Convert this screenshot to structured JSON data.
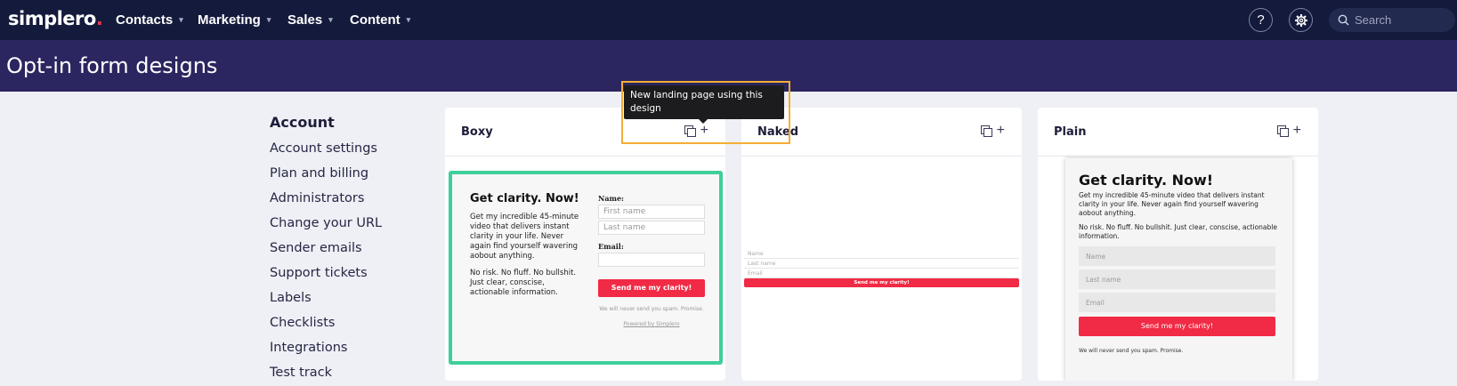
{
  "app": {
    "logo_text": "simplero",
    "logo_dot": "."
  },
  "nav": {
    "items": [
      {
        "label": "Contacts"
      },
      {
        "label": "Marketing"
      },
      {
        "label": "Sales"
      },
      {
        "label": "Content"
      }
    ],
    "help_label": "?",
    "search_placeholder": "Search"
  },
  "page": {
    "title": "Opt-in form designs"
  },
  "sidebar": {
    "heading": "Account",
    "items": [
      {
        "label": "Account settings"
      },
      {
        "label": "Plan and billing"
      },
      {
        "label": "Administrators"
      },
      {
        "label": "Change your URL"
      },
      {
        "label": "Sender emails"
      },
      {
        "label": "Support tickets"
      },
      {
        "label": "Labels"
      },
      {
        "label": "Checklists"
      },
      {
        "label": "Integrations"
      },
      {
        "label": "Test track"
      }
    ]
  },
  "designs": [
    {
      "title": "Boxy"
    },
    {
      "title": "Naked"
    },
    {
      "title": "Plain"
    }
  ],
  "tooltip": {
    "text": "New landing page using this design"
  },
  "preview": {
    "headline": "Get clarity. Now!",
    "body_boxy": "Get my incredible 45-minute video that delivers instant clarity in your life. Never again find yourself wavering aobout anything.",
    "body2_boxy": "No risk. No fluff. No bullshit. Just clear, conscise, actionable information.",
    "name_label": "Name:",
    "email_label": "Email:",
    "first_name": "First name",
    "last_name": "Last name",
    "name_short": "Name",
    "last_name_short": "Last name",
    "email_short": "Email",
    "button": "Send me my clarity!",
    "spam_note": "We will never send you spam. Promise.",
    "powered": "Powered by Simplero",
    "body_plain": "Get my incredible 45-minute video that delivers instant clarity in your life. Never again find yourself wavering aobout anything.",
    "body2_plain": "No risk. No fluff. No bullshit. Just clear, conscise, actionable information."
  },
  "colors": {
    "nav_bg": "#141a3c",
    "header_bg": "#2b2660",
    "accent_red": "#f12a45",
    "selected_border": "#3ecf9a",
    "highlight": "#f4ae36"
  }
}
